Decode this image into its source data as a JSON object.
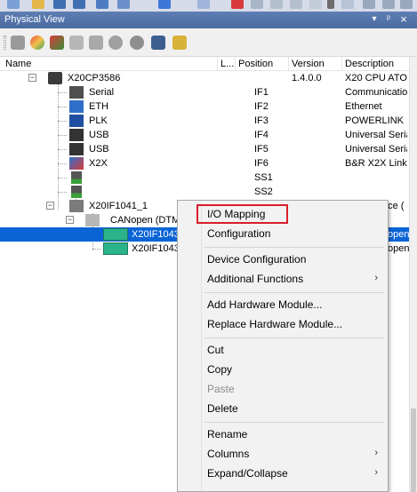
{
  "panel": {
    "title": "Physical View",
    "pin_glyph": "▾",
    "autohide_glyph": "ᵖ",
    "close_glyph": "×"
  },
  "columns": {
    "name": "Name",
    "l": "L...",
    "position": "Position",
    "version": "Version",
    "description": "Description"
  },
  "tree": [
    {
      "name": "X20CP3586",
      "position": "",
      "version": "1.4.0.0",
      "description": "X20 CPU ATO",
      "icon": "cpu-icon",
      "expander": "−"
    },
    {
      "name": "Serial",
      "position": "IF1",
      "version": "",
      "description": "Communication",
      "icon": "serial-port-icon"
    },
    {
      "name": "ETH",
      "position": "IF2",
      "version": "",
      "description": "Ethernet",
      "icon": "ethernet-icon"
    },
    {
      "name": "PLK",
      "position": "IF3",
      "version": "",
      "description": "POWERLINK",
      "icon": "powerlink-icon"
    },
    {
      "name": "USB",
      "position": "IF4",
      "version": "",
      "description": "Universal Seria",
      "icon": "usb-icon"
    },
    {
      "name": "USB",
      "position": "IF5",
      "version": "",
      "description": "Universal Seria",
      "icon": "usb-icon"
    },
    {
      "name": "X2X",
      "position": "IF6",
      "version": "",
      "description": "B&R X2X Link",
      "icon": "x2x-icon"
    },
    {
      "name": "",
      "position": "SS1",
      "version": "",
      "description": "",
      "icon": "slot-icon"
    },
    {
      "name": "",
      "position": "SS2",
      "version": "",
      "description": "",
      "icon": "slot-icon"
    },
    {
      "name": "X20IF1041_1",
      "position": "",
      "version": "",
      "description": "ace (",
      "icon": "module-icon",
      "expander": "−"
    },
    {
      "name": "CANopen (DTM",
      "position": "",
      "version": "",
      "description": "",
      "icon": "canopen-icon",
      "expander": "−"
    },
    {
      "name": "X20IF1043",
      "position": "",
      "version": "",
      "description": "open",
      "icon": "device-icon",
      "selected": true
    },
    {
      "name": "X20IF1043",
      "position": "",
      "version": "",
      "description": "open",
      "icon": "device-icon"
    }
  ],
  "context_menu": {
    "io_mapping": "I/O Mapping",
    "configuration": "Configuration",
    "device_configuration": "Device Configuration",
    "additional_functions": "Additional Functions",
    "add_hardware_module": "Add Hardware Module...",
    "replace_hardware_module": "Replace Hardware Module...",
    "cut": "Cut",
    "copy": "Copy",
    "paste": "Paste",
    "delete": "Delete",
    "rename": "Rename",
    "columns": "Columns",
    "expand_collapse": "Expand/Collapse",
    "submenu_arrow": "›"
  },
  "colors": {
    "selection": "#0a64d6",
    "highlight_box": "#d81e2a",
    "header": "#4a6aa0"
  }
}
